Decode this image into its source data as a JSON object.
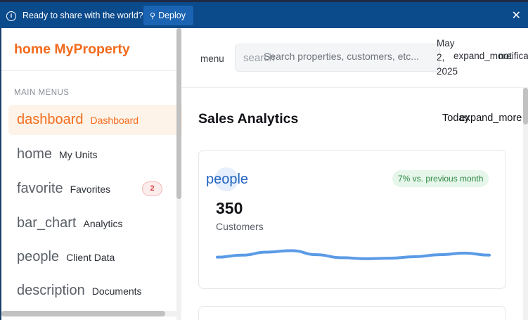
{
  "banner": {
    "message": "Ready to share with the world?",
    "deploy_label": "Deploy",
    "info_icon": "i",
    "close_icon": "✕",
    "colors": {
      "background": "#0b4a8b",
      "button": "#1b63b3"
    }
  },
  "sidebar": {
    "brand": "home MyProperty",
    "section_label": "MAIN MENUS",
    "accent_color": "#f26b1d",
    "items": [
      {
        "icon": "dashboard",
        "label": "Dashboard",
        "active": true
      },
      {
        "icon": "home",
        "label": "My Units"
      },
      {
        "icon": "favorite",
        "label": "Favorites",
        "badge": "2"
      },
      {
        "icon": "bar_chart",
        "label": "Analytics"
      },
      {
        "icon": "people",
        "label": "Client Data"
      },
      {
        "icon": "description",
        "label": "Documents"
      }
    ]
  },
  "header": {
    "menu_label": "menu",
    "search_icon_text": "search",
    "search_placeholder": "Search properties, customers, etc...",
    "date_lines": [
      "May",
      "2,",
      "2025"
    ],
    "date_expand": "expand_more",
    "notifications": "notifica"
  },
  "main": {
    "title": "Sales Analytics",
    "period_label": "Today",
    "period_icon": "expand_more",
    "cards": [
      {
        "icon": "people",
        "trend": "7% vs. previous month",
        "value": "350",
        "label": "Customers",
        "sparkline": [
          0.3,
          0.5,
          0.8,
          0.95,
          0.55,
          0.25,
          0.15,
          0.2,
          0.35,
          0.55,
          0.7,
          0.5
        ],
        "sparkline_color": "#5b9be6"
      }
    ]
  }
}
